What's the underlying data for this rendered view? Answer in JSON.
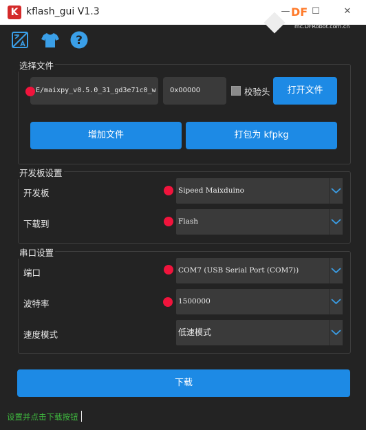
{
  "window": {
    "title": "kflash_gui V1.3",
    "logo_letter": "K",
    "watermark_brand": "DF",
    "watermark_site": "mc.DFRobot.com.cn",
    "minimize_glyph": "—",
    "maximize_glyph": "☐",
    "close_glyph": "✕"
  },
  "toolbar": {
    "icons": [
      "language-icon",
      "tshirt-icon",
      "help-icon"
    ],
    "help_glyph": "?"
  },
  "file_group": {
    "title": "选择文件",
    "file_path": "E/maixpy_v0.5.0_31_gd3e71c0_w",
    "address": "0x00000",
    "checksum_label": "校验头",
    "checksum_checked": false,
    "open_button": "打开文件",
    "add_button": "增加文件",
    "pack_button": "打包为 kfpkg"
  },
  "board_group": {
    "title": "开发板设置",
    "board_label": "开发板",
    "board_value": "Sipeed Maixduino",
    "download_to_label": "下载到",
    "download_to_value": "Flash"
  },
  "serial_group": {
    "title": "串口设置",
    "port_label": "端口",
    "port_value": "COM7 (USB Serial Port (COM7))",
    "baud_label": "波特率",
    "baud_value": "1500000",
    "speed_label": "速度模式",
    "speed_value": "低速模式"
  },
  "download_button": "下载",
  "status_text": "设置并点击下载按钮",
  "colors": {
    "accent": "#1d8ae5",
    "marker": "#f0143c",
    "status": "#3fb83f",
    "background": "#232323"
  }
}
